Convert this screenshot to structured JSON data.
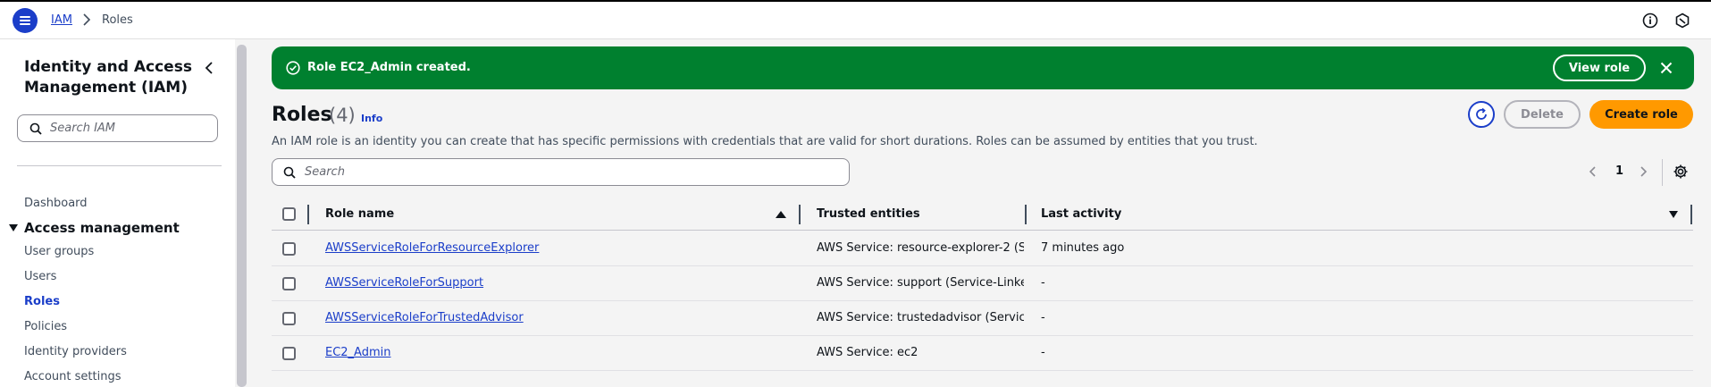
{
  "topbar": {
    "breadcrumb": [
      "IAM",
      "Roles"
    ],
    "icons": [
      "menu-icon",
      "info-icon",
      "notifications-icon"
    ]
  },
  "sidebar": {
    "title": "Identity and Access Management (IAM)",
    "search_placeholder": "Search IAM",
    "dashboard": "Dashboard",
    "group_label": "Access management",
    "items": [
      {
        "label": "User groups",
        "active": false
      },
      {
        "label": "Users",
        "active": false
      },
      {
        "label": "Roles",
        "active": true
      },
      {
        "label": "Policies",
        "active": false
      },
      {
        "label": "Identity providers",
        "active": false
      },
      {
        "label": "Account settings",
        "active": false
      }
    ]
  },
  "flash": {
    "message": "Role EC2_Admin created.",
    "action_label": "View role",
    "color": "#00802f"
  },
  "header": {
    "title": "Roles",
    "count": "(4)",
    "info": "Info",
    "description": "An IAM role is an identity you can create that has specific permissions with credentials that are valid for short durations. Roles can be assumed by entities that you trust.",
    "delete_label": "Delete",
    "create_label": "Create role",
    "accent": "#ff9900"
  },
  "search": {
    "placeholder": "Search"
  },
  "pagination": {
    "page": "1"
  },
  "table": {
    "columns": [
      "Role name",
      "Trusted entities",
      "Last activity"
    ],
    "rows": [
      {
        "name": "AWSServiceRoleForResourceExplorer",
        "trusted_prefix": "AWS Service: resource-explorer-2 ",
        "trusted_suffix": "(Service-Linked role)",
        "last_activity": "7 minutes ago"
      },
      {
        "name": "AWSServiceRoleForSupport",
        "trusted_prefix": "AWS Service: support ",
        "trusted_suffix": "(Service-Linked role)",
        "last_activity": "-"
      },
      {
        "name": "AWSServiceRoleForTrustedAdvisor",
        "trusted_prefix": "AWS Service: trustedadvisor ",
        "trusted_suffix": "(Service-Linked role)",
        "last_activity": "-"
      },
      {
        "name": "EC2_Admin",
        "trusted_prefix": "AWS Service: ec2",
        "trusted_suffix": "",
        "last_activity": "-"
      }
    ]
  }
}
